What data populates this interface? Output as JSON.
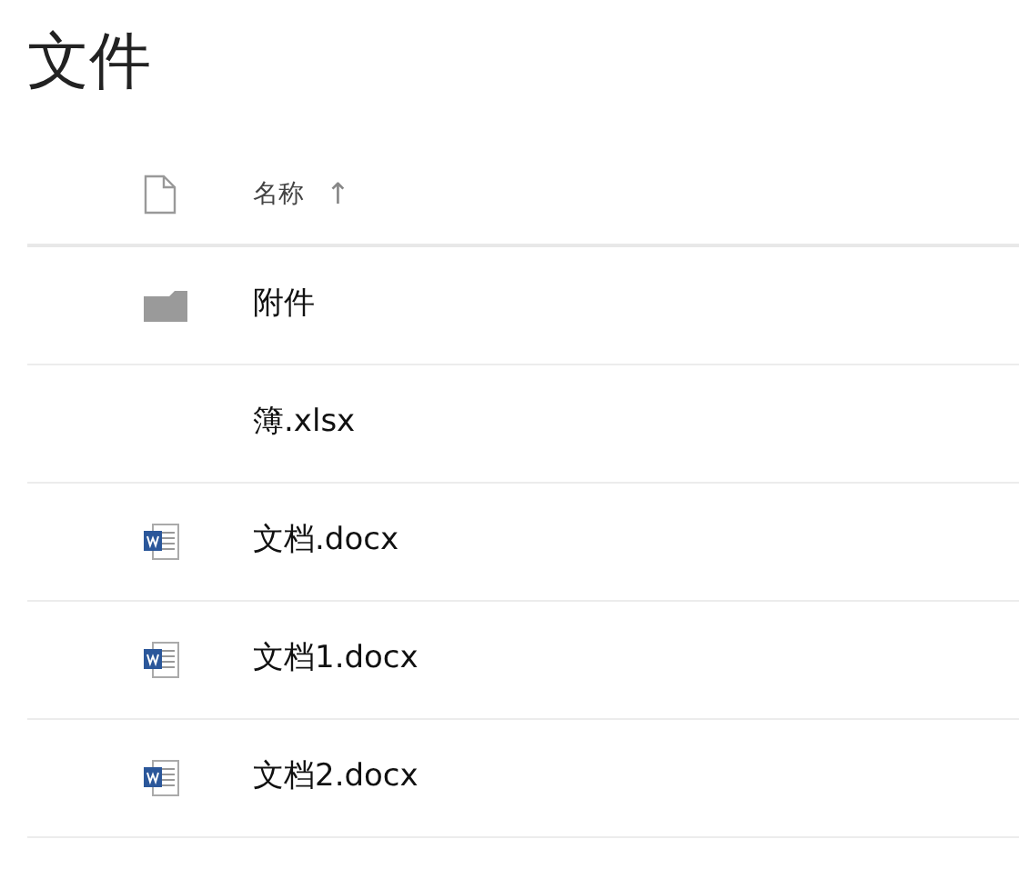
{
  "title": "文件",
  "header": {
    "column": "名称",
    "sort_arrow": "↑"
  },
  "files": [
    {
      "kind": "folder",
      "name": "附件"
    },
    {
      "kind": "none",
      "name": "簿.xlsx"
    },
    {
      "kind": "word",
      "name": "文档.docx"
    },
    {
      "kind": "word",
      "name": "文档1.docx"
    },
    {
      "kind": "word",
      "name": "文档2.docx"
    }
  ]
}
